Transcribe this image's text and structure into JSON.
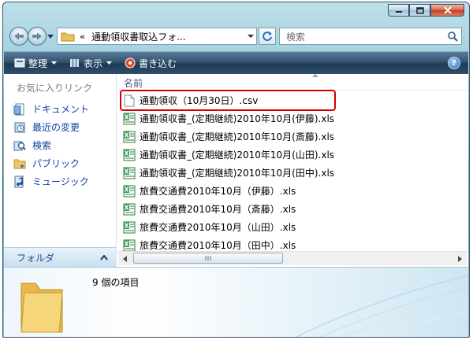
{
  "window": {
    "address_path": "通動領収書取込フォ...",
    "search_placeholder": "検索"
  },
  "toolbar": {
    "organize": "整理",
    "views": "表示",
    "burn": "書き込む",
    "help": "?"
  },
  "navpane": {
    "favorites_header": "お気に入りリンク",
    "items": [
      {
        "label": "ドキュメント",
        "icon": "documents-icon"
      },
      {
        "label": "最近の変更",
        "icon": "recent-changes-icon"
      },
      {
        "label": "検索",
        "icon": "searches-icon"
      },
      {
        "label": "パブリック",
        "icon": "public-folder-icon"
      },
      {
        "label": "ミュージック",
        "icon": "music-icon"
      }
    ],
    "folders_label": "フォルダ"
  },
  "content": {
    "column_name": "名前",
    "files": [
      {
        "name": "通勤領収（10月30日）.csv",
        "type": "csv",
        "highlighted": true
      },
      {
        "name": "通勤領収書_(定期継続)2010年10月(伊藤).xls",
        "type": "xls"
      },
      {
        "name": "通勤領収書_(定期継続)2010年10月(斎藤).xls",
        "type": "xls"
      },
      {
        "name": "通勤領収書_(定期継続)2010年10月(山田).xls",
        "type": "xls"
      },
      {
        "name": "通勤領収書_(定期継続)2010年10月(田中).xls",
        "type": "xls"
      },
      {
        "name": "旅費交通費2010年10月（伊藤）.xls",
        "type": "xls"
      },
      {
        "name": "旅費交通費2010年10月（斎藤）.xls",
        "type": "xls"
      },
      {
        "name": "旅費交通費2010年10月（山田）.xls",
        "type": "xls"
      },
      {
        "name": "旅費交通費2010年10月（田中）.xls",
        "type": "xls"
      }
    ]
  },
  "details": {
    "item_count": "9 個の項目"
  },
  "colors": {
    "highlight": "#d40000",
    "link": "#0d3fa6",
    "toolbar": "#2f4e6b"
  }
}
